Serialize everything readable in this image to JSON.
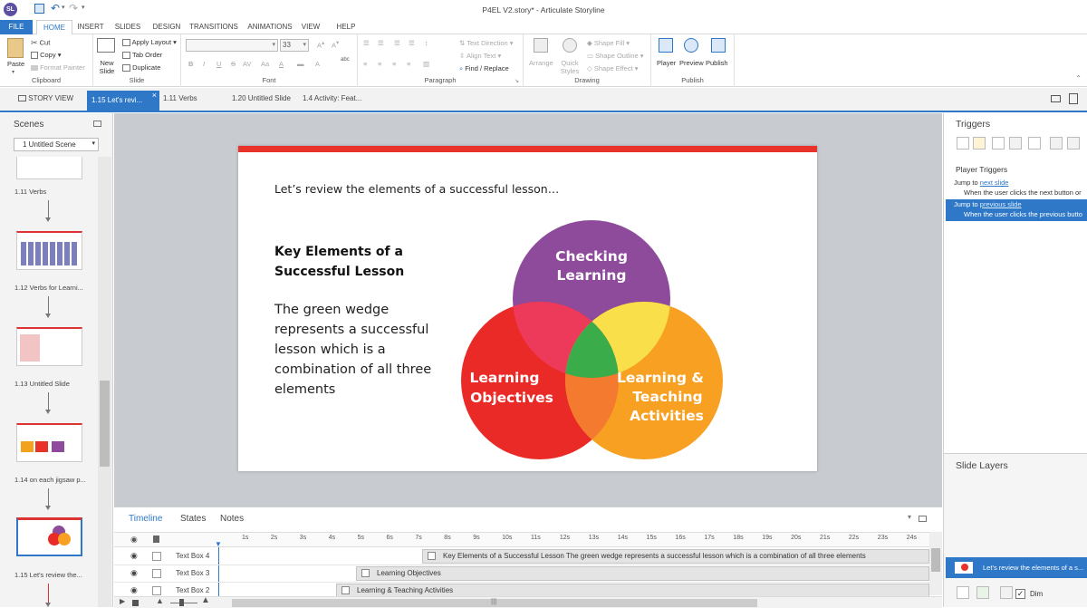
{
  "app": {
    "title": "P4EL V2.story* - Articulate Storyline",
    "logo": "SL"
  },
  "ribbon_tabs": [
    "FILE",
    "HOME",
    "INSERT",
    "SLIDES",
    "DESIGN",
    "TRANSITIONS",
    "ANIMATIONS",
    "VIEW",
    "HELP"
  ],
  "clipboard": {
    "paste": "Paste",
    "cut": "Cut",
    "copy": "Copy",
    "format_painter": "Format Painter",
    "label": "Clipboard"
  },
  "slide_group": {
    "new_slide": "New Slide",
    "apply_layout": "Apply Layout",
    "tab_order": "Tab Order",
    "duplicate": "Duplicate",
    "label": "Slide"
  },
  "font_group": {
    "font_size": "33",
    "label": "Font",
    "bold": "B",
    "italic": "I",
    "underline": "U",
    "strike": "S",
    "abc": "abc"
  },
  "paragraph_group": {
    "text_direction": "Text Direction",
    "align_text": "Align Text",
    "find_replace": "Find / Replace",
    "label": "Paragraph"
  },
  "drawing_group": {
    "arrange": "Arrange",
    "quick_styles": "Quick Styles",
    "shape_fill": "Shape Fill",
    "shape_outline": "Shape Outline",
    "shape_effect": "Shape Effect",
    "label": "Drawing"
  },
  "publish_group": {
    "player": "Player",
    "preview": "Preview",
    "publish": "Publish",
    "label": "Publish"
  },
  "doc_tabs": [
    "STORY VIEW",
    "1.15 Let's revi...",
    "1.11 Verbs",
    "1.20 Untitled Slide",
    "1.4 Activity: Feat..."
  ],
  "scenes": {
    "title": "Scenes",
    "dropdown": "1 Untitled Scene",
    "slides": [
      "1.11 Verbs",
      "1.12 Verbs for Learni...",
      "1.13 Untitled Slide",
      "1.14 on each jigsaw p...",
      "1.15 Let's review the..."
    ]
  },
  "slide": {
    "intro": "Let’s review the elements of a successful lesson…",
    "heading": "Key Elements of a Successful Lesson",
    "body": "The green wedge represents a successful lesson which is a combination of all three elements",
    "circle_top": "Checking Learning",
    "circle_left": "Learning Objectives",
    "circle_right": "Learning & Teaching Activities",
    "colors": {
      "top": "#8e4a9b",
      "left": "#ea2a26",
      "right": "#f7a022",
      "top_left": "#ee3a5a",
      "top_right": "#f9e04a",
      "left_right": "#f37a2e",
      "center": "#3aac4a",
      "bar": "#e8322a"
    }
  },
  "timeline": {
    "tabs": [
      "Timeline",
      "States",
      "Notes"
    ],
    "ticks": [
      "1s",
      "2s",
      "3s",
      "4s",
      "5s",
      "6s",
      "7s",
      "8s",
      "9s",
      "10s",
      "11s",
      "12s",
      "13s",
      "14s",
      "15s",
      "16s",
      "17s",
      "18s",
      "19s",
      "20s",
      "21s",
      "22s",
      "23s",
      "24s"
    ],
    "rows": [
      {
        "name": "Text Box 4",
        "bar": "Key Elements of a Successful Lesson The green wedge represents a successful lesson which is a combination of all three elements"
      },
      {
        "name": "Text Box 3",
        "bar": "Learning Objectives"
      },
      {
        "name": "Text Box 2",
        "bar": "Learning & Teaching Activities"
      }
    ]
  },
  "triggers": {
    "title": "Triggers",
    "section": "Player Triggers",
    "items": [
      {
        "action": "Jump to",
        "link": "next slide",
        "condition": "When the user clicks the next button or"
      },
      {
        "action": "Jump to",
        "link": "previous slide",
        "condition": "When the user clicks the previous butto"
      }
    ]
  },
  "layers": {
    "title": "Slide Layers",
    "base": "Let’s review the elements of a s...",
    "dim": "Dim"
  }
}
